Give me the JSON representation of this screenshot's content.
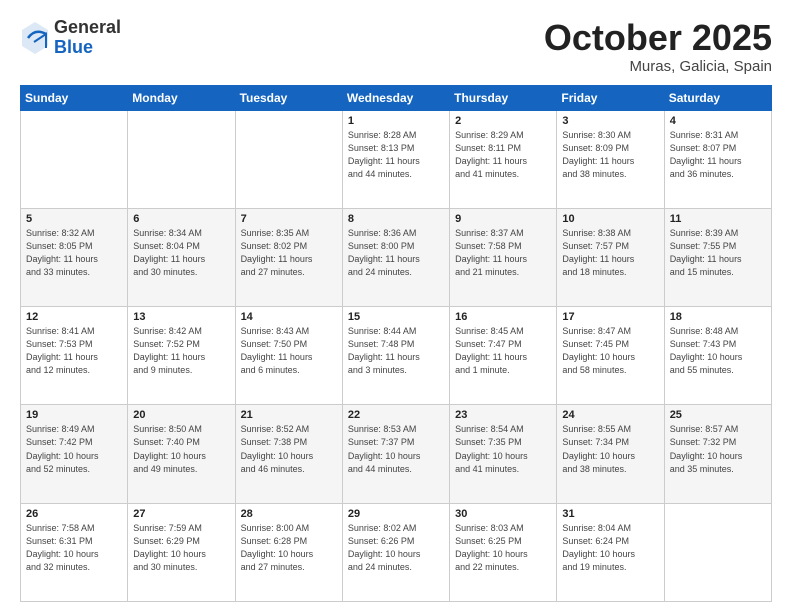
{
  "header": {
    "logo": {
      "general": "General",
      "blue": "Blue"
    },
    "title": "October 2025",
    "location": "Muras, Galicia, Spain"
  },
  "weekdays": [
    "Sunday",
    "Monday",
    "Tuesday",
    "Wednesday",
    "Thursday",
    "Friday",
    "Saturday"
  ],
  "weeks": [
    [
      {
        "day": "",
        "info": ""
      },
      {
        "day": "",
        "info": ""
      },
      {
        "day": "",
        "info": ""
      },
      {
        "day": "1",
        "info": "Sunrise: 8:28 AM\nSunset: 8:13 PM\nDaylight: 11 hours\nand 44 minutes."
      },
      {
        "day": "2",
        "info": "Sunrise: 8:29 AM\nSunset: 8:11 PM\nDaylight: 11 hours\nand 41 minutes."
      },
      {
        "day": "3",
        "info": "Sunrise: 8:30 AM\nSunset: 8:09 PM\nDaylight: 11 hours\nand 38 minutes."
      },
      {
        "day": "4",
        "info": "Sunrise: 8:31 AM\nSunset: 8:07 PM\nDaylight: 11 hours\nand 36 minutes."
      }
    ],
    [
      {
        "day": "5",
        "info": "Sunrise: 8:32 AM\nSunset: 8:05 PM\nDaylight: 11 hours\nand 33 minutes."
      },
      {
        "day": "6",
        "info": "Sunrise: 8:34 AM\nSunset: 8:04 PM\nDaylight: 11 hours\nand 30 minutes."
      },
      {
        "day": "7",
        "info": "Sunrise: 8:35 AM\nSunset: 8:02 PM\nDaylight: 11 hours\nand 27 minutes."
      },
      {
        "day": "8",
        "info": "Sunrise: 8:36 AM\nSunset: 8:00 PM\nDaylight: 11 hours\nand 24 minutes."
      },
      {
        "day": "9",
        "info": "Sunrise: 8:37 AM\nSunset: 7:58 PM\nDaylight: 11 hours\nand 21 minutes."
      },
      {
        "day": "10",
        "info": "Sunrise: 8:38 AM\nSunset: 7:57 PM\nDaylight: 11 hours\nand 18 minutes."
      },
      {
        "day": "11",
        "info": "Sunrise: 8:39 AM\nSunset: 7:55 PM\nDaylight: 11 hours\nand 15 minutes."
      }
    ],
    [
      {
        "day": "12",
        "info": "Sunrise: 8:41 AM\nSunset: 7:53 PM\nDaylight: 11 hours\nand 12 minutes."
      },
      {
        "day": "13",
        "info": "Sunrise: 8:42 AM\nSunset: 7:52 PM\nDaylight: 11 hours\nand 9 minutes."
      },
      {
        "day": "14",
        "info": "Sunrise: 8:43 AM\nSunset: 7:50 PM\nDaylight: 11 hours\nand 6 minutes."
      },
      {
        "day": "15",
        "info": "Sunrise: 8:44 AM\nSunset: 7:48 PM\nDaylight: 11 hours\nand 3 minutes."
      },
      {
        "day": "16",
        "info": "Sunrise: 8:45 AM\nSunset: 7:47 PM\nDaylight: 11 hours\nand 1 minute."
      },
      {
        "day": "17",
        "info": "Sunrise: 8:47 AM\nSunset: 7:45 PM\nDaylight: 10 hours\nand 58 minutes."
      },
      {
        "day": "18",
        "info": "Sunrise: 8:48 AM\nSunset: 7:43 PM\nDaylight: 10 hours\nand 55 minutes."
      }
    ],
    [
      {
        "day": "19",
        "info": "Sunrise: 8:49 AM\nSunset: 7:42 PM\nDaylight: 10 hours\nand 52 minutes."
      },
      {
        "day": "20",
        "info": "Sunrise: 8:50 AM\nSunset: 7:40 PM\nDaylight: 10 hours\nand 49 minutes."
      },
      {
        "day": "21",
        "info": "Sunrise: 8:52 AM\nSunset: 7:38 PM\nDaylight: 10 hours\nand 46 minutes."
      },
      {
        "day": "22",
        "info": "Sunrise: 8:53 AM\nSunset: 7:37 PM\nDaylight: 10 hours\nand 44 minutes."
      },
      {
        "day": "23",
        "info": "Sunrise: 8:54 AM\nSunset: 7:35 PM\nDaylight: 10 hours\nand 41 minutes."
      },
      {
        "day": "24",
        "info": "Sunrise: 8:55 AM\nSunset: 7:34 PM\nDaylight: 10 hours\nand 38 minutes."
      },
      {
        "day": "25",
        "info": "Sunrise: 8:57 AM\nSunset: 7:32 PM\nDaylight: 10 hours\nand 35 minutes."
      }
    ],
    [
      {
        "day": "26",
        "info": "Sunrise: 7:58 AM\nSunset: 6:31 PM\nDaylight: 10 hours\nand 32 minutes."
      },
      {
        "day": "27",
        "info": "Sunrise: 7:59 AM\nSunset: 6:29 PM\nDaylight: 10 hours\nand 30 minutes."
      },
      {
        "day": "28",
        "info": "Sunrise: 8:00 AM\nSunset: 6:28 PM\nDaylight: 10 hours\nand 27 minutes."
      },
      {
        "day": "29",
        "info": "Sunrise: 8:02 AM\nSunset: 6:26 PM\nDaylight: 10 hours\nand 24 minutes."
      },
      {
        "day": "30",
        "info": "Sunrise: 8:03 AM\nSunset: 6:25 PM\nDaylight: 10 hours\nand 22 minutes."
      },
      {
        "day": "31",
        "info": "Sunrise: 8:04 AM\nSunset: 6:24 PM\nDaylight: 10 hours\nand 19 minutes."
      },
      {
        "day": "",
        "info": ""
      }
    ]
  ]
}
